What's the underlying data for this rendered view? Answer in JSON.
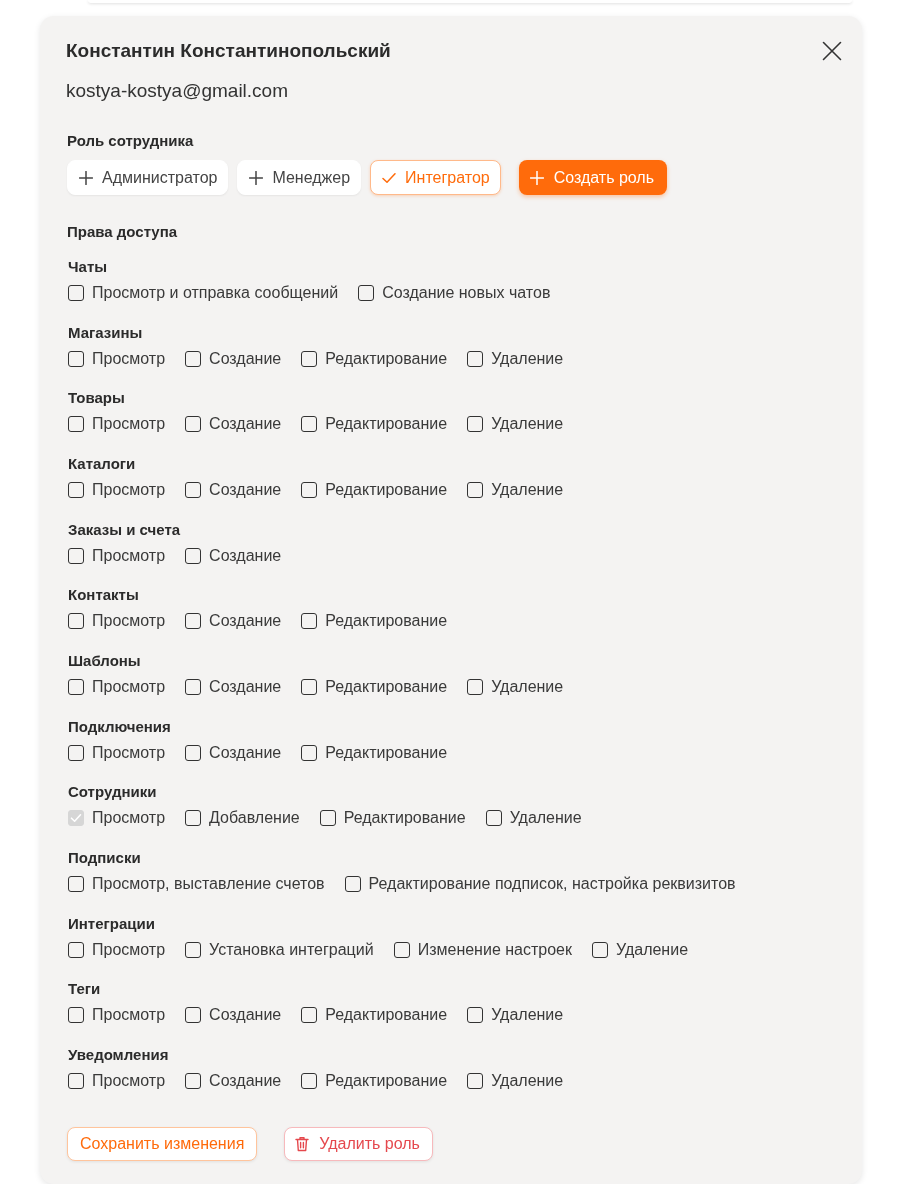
{
  "employee": {
    "name": "Константин Константинопольский",
    "email": "kostya-kostya@gmail.com"
  },
  "roles": {
    "title": "Роль сотрудника",
    "items": [
      {
        "label": "Администратор",
        "selected": false
      },
      {
        "label": "Менеджер",
        "selected": false
      },
      {
        "label": "Интегратор",
        "selected": true
      }
    ],
    "create_button": "Создать роль"
  },
  "permissions": {
    "title": "Права доступа",
    "groups": [
      {
        "title": "Чаты",
        "options": [
          {
            "label": "Просмотр и отправка сообщений",
            "checked": false,
            "disabled": false
          },
          {
            "label": "Создание новых чатов",
            "checked": false,
            "disabled": false
          }
        ]
      },
      {
        "title": "Магазины",
        "options": [
          {
            "label": "Просмотр",
            "checked": false,
            "disabled": false
          },
          {
            "label": "Создание",
            "checked": false,
            "disabled": false
          },
          {
            "label": "Редактирование",
            "checked": false,
            "disabled": false
          },
          {
            "label": "Удаление",
            "checked": false,
            "disabled": false
          }
        ]
      },
      {
        "title": "Товары",
        "options": [
          {
            "label": "Просмотр",
            "checked": false,
            "disabled": false
          },
          {
            "label": "Создание",
            "checked": false,
            "disabled": false
          },
          {
            "label": "Редактирование",
            "checked": false,
            "disabled": false
          },
          {
            "label": "Удаление",
            "checked": false,
            "disabled": false
          }
        ]
      },
      {
        "title": "Каталоги",
        "options": [
          {
            "label": "Просмотр",
            "checked": false,
            "disabled": false
          },
          {
            "label": "Создание",
            "checked": false,
            "disabled": false
          },
          {
            "label": "Редактирование",
            "checked": false,
            "disabled": false
          },
          {
            "label": "Удаление",
            "checked": false,
            "disabled": false
          }
        ]
      },
      {
        "title": "Заказы и счета",
        "options": [
          {
            "label": "Просмотр",
            "checked": false,
            "disabled": false
          },
          {
            "label": "Создание",
            "checked": false,
            "disabled": false
          }
        ]
      },
      {
        "title": "Контакты",
        "options": [
          {
            "label": "Просмотр",
            "checked": false,
            "disabled": false
          },
          {
            "label": "Создание",
            "checked": false,
            "disabled": false
          },
          {
            "label": "Редактирование",
            "checked": false,
            "disabled": false
          }
        ]
      },
      {
        "title": "Шаблоны",
        "options": [
          {
            "label": "Просмотр",
            "checked": false,
            "disabled": false
          },
          {
            "label": "Создание",
            "checked": false,
            "disabled": false
          },
          {
            "label": "Редактирование",
            "checked": false,
            "disabled": false
          },
          {
            "label": "Удаление",
            "checked": false,
            "disabled": false
          }
        ]
      },
      {
        "title": "Подключения",
        "options": [
          {
            "label": "Просмотр",
            "checked": false,
            "disabled": false
          },
          {
            "label": "Создание",
            "checked": false,
            "disabled": false
          },
          {
            "label": "Редактирование",
            "checked": false,
            "disabled": false
          }
        ]
      },
      {
        "title": "Сотрудники",
        "options": [
          {
            "label": "Просмотр",
            "checked": true,
            "disabled": true
          },
          {
            "label": "Добавление",
            "checked": false,
            "disabled": false
          },
          {
            "label": "Редактирование",
            "checked": false,
            "disabled": false
          },
          {
            "label": "Удаление",
            "checked": false,
            "disabled": false
          }
        ]
      },
      {
        "title": "Подписки",
        "options": [
          {
            "label": "Просмотр, выставление счетов",
            "checked": false,
            "disabled": false
          },
          {
            "label": "Редактирование подписок, настройка реквизитов",
            "checked": false,
            "disabled": false
          }
        ]
      },
      {
        "title": "Интеграции",
        "options": [
          {
            "label": "Просмотр",
            "checked": false,
            "disabled": false
          },
          {
            "label": "Установка интеграций",
            "checked": false,
            "disabled": false
          },
          {
            "label": "Изменение настроек",
            "checked": false,
            "disabled": false
          },
          {
            "label": "Удаление",
            "checked": false,
            "disabled": false
          }
        ]
      },
      {
        "title": "Теги",
        "options": [
          {
            "label": "Просмотр",
            "checked": false,
            "disabled": false
          },
          {
            "label": "Создание",
            "checked": false,
            "disabled": false
          },
          {
            "label": "Редактирование",
            "checked": false,
            "disabled": false
          },
          {
            "label": "Удаление",
            "checked": false,
            "disabled": false
          }
        ]
      },
      {
        "title": "Уведомления",
        "options": [
          {
            "label": "Просмотр",
            "checked": false,
            "disabled": false
          },
          {
            "label": "Создание",
            "checked": false,
            "disabled": false
          },
          {
            "label": "Редактирование",
            "checked": false,
            "disabled": false
          },
          {
            "label": "Удаление",
            "checked": false,
            "disabled": false
          }
        ]
      }
    ]
  },
  "actions": {
    "save": "Сохранить изменения",
    "delete": "Удалить роль"
  }
}
